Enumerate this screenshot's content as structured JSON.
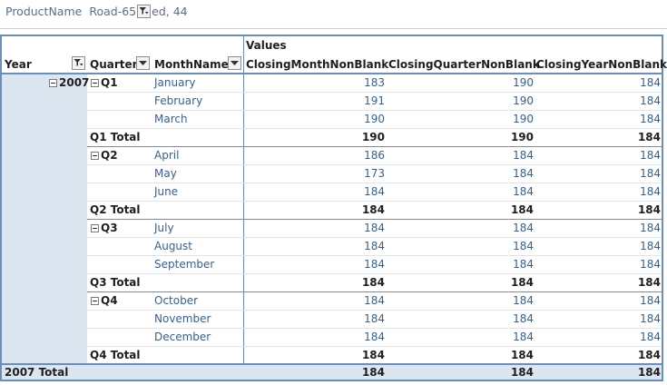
{
  "filter": {
    "field": "ProductName",
    "value_part1": "Road-65",
    "value_part2": "ed, 44"
  },
  "header": {
    "values_label": "Values",
    "columns": [
      "Year",
      "Quarter",
      "MonthName",
      "ClosingMonthNonBlank",
      "ClosingQuarterNonBlank",
      "ClosingYearNonBlank"
    ]
  },
  "year": "2007",
  "quarters": [
    {
      "label": "Q1",
      "months": [
        {
          "name": "January",
          "v": [
            "183",
            "190",
            "184"
          ]
        },
        {
          "name": "February",
          "v": [
            "191",
            "190",
            "184"
          ]
        },
        {
          "name": "March",
          "v": [
            "190",
            "190",
            "184"
          ]
        }
      ],
      "total_label": "Q1 Total",
      "total": [
        "190",
        "190",
        "184"
      ]
    },
    {
      "label": "Q2",
      "months": [
        {
          "name": "April",
          "v": [
            "186",
            "184",
            "184"
          ]
        },
        {
          "name": "May",
          "v": [
            "173",
            "184",
            "184"
          ]
        },
        {
          "name": "June",
          "v": [
            "184",
            "184",
            "184"
          ]
        }
      ],
      "total_label": "Q2 Total",
      "total": [
        "184",
        "184",
        "184"
      ]
    },
    {
      "label": "Q3",
      "months": [
        {
          "name": "July",
          "v": [
            "184",
            "184",
            "184"
          ]
        },
        {
          "name": "August",
          "v": [
            "184",
            "184",
            "184"
          ]
        },
        {
          "name": "September",
          "v": [
            "184",
            "184",
            "184"
          ]
        }
      ],
      "total_label": "Q3 Total",
      "total": [
        "184",
        "184",
        "184"
      ]
    },
    {
      "label": "Q4",
      "months": [
        {
          "name": "October",
          "v": [
            "184",
            "184",
            "184"
          ]
        },
        {
          "name": "November",
          "v": [
            "184",
            "184",
            "184"
          ]
        },
        {
          "name": "December",
          "v": [
            "184",
            "184",
            "184"
          ]
        }
      ],
      "total_label": "Q4 Total",
      "total": [
        "184",
        "184",
        "184"
      ]
    }
  ],
  "grand_total": {
    "label": "2007 Total",
    "values": [
      "184",
      "184",
      "184"
    ]
  },
  "colors": {
    "border": "#6b8fbd",
    "band": "#dce6f1",
    "value_text": "#3a5f8f"
  }
}
